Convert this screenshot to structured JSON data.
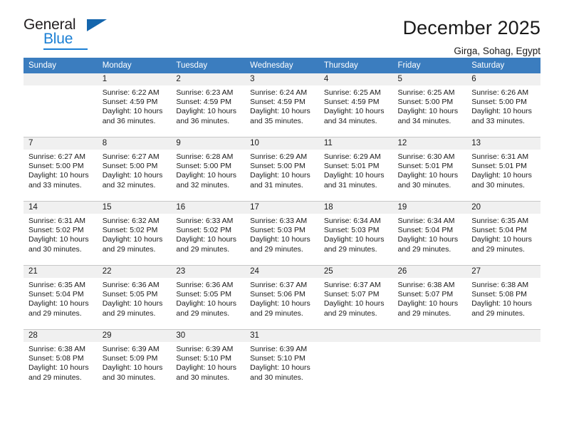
{
  "logo": {
    "word_top": "General",
    "word_bottom": "Blue",
    "accent_color": "#1b7fd4"
  },
  "header": {
    "title": "December 2025",
    "subtitle": "Girga, Sohag, Egypt",
    "header_bg": "#3b7dbf",
    "daynum_bg": "#f0f0f0"
  },
  "weekdays": [
    "Sunday",
    "Monday",
    "Tuesday",
    "Wednesday",
    "Thursday",
    "Friday",
    "Saturday"
  ],
  "labels": {
    "sunrise_prefix": "Sunrise:",
    "sunset_prefix": "Sunset:",
    "daylight_prefix": "Daylight:"
  },
  "weeks": [
    [
      {
        "day": "",
        "sunrise": "",
        "sunset": "",
        "daylight": ""
      },
      {
        "day": "1",
        "sunrise": "Sunrise: 6:22 AM",
        "sunset": "Sunset: 4:59 PM",
        "daylight": "Daylight: 10 hours and 36 minutes."
      },
      {
        "day": "2",
        "sunrise": "Sunrise: 6:23 AM",
        "sunset": "Sunset: 4:59 PM",
        "daylight": "Daylight: 10 hours and 36 minutes."
      },
      {
        "day": "3",
        "sunrise": "Sunrise: 6:24 AM",
        "sunset": "Sunset: 4:59 PM",
        "daylight": "Daylight: 10 hours and 35 minutes."
      },
      {
        "day": "4",
        "sunrise": "Sunrise: 6:25 AM",
        "sunset": "Sunset: 4:59 PM",
        "daylight": "Daylight: 10 hours and 34 minutes."
      },
      {
        "day": "5",
        "sunrise": "Sunrise: 6:25 AM",
        "sunset": "Sunset: 5:00 PM",
        "daylight": "Daylight: 10 hours and 34 minutes."
      },
      {
        "day": "6",
        "sunrise": "Sunrise: 6:26 AM",
        "sunset": "Sunset: 5:00 PM",
        "daylight": "Daylight: 10 hours and 33 minutes."
      }
    ],
    [
      {
        "day": "7",
        "sunrise": "Sunrise: 6:27 AM",
        "sunset": "Sunset: 5:00 PM",
        "daylight": "Daylight: 10 hours and 33 minutes."
      },
      {
        "day": "8",
        "sunrise": "Sunrise: 6:27 AM",
        "sunset": "Sunset: 5:00 PM",
        "daylight": "Daylight: 10 hours and 32 minutes."
      },
      {
        "day": "9",
        "sunrise": "Sunrise: 6:28 AM",
        "sunset": "Sunset: 5:00 PM",
        "daylight": "Daylight: 10 hours and 32 minutes."
      },
      {
        "day": "10",
        "sunrise": "Sunrise: 6:29 AM",
        "sunset": "Sunset: 5:00 PM",
        "daylight": "Daylight: 10 hours and 31 minutes."
      },
      {
        "day": "11",
        "sunrise": "Sunrise: 6:29 AM",
        "sunset": "Sunset: 5:01 PM",
        "daylight": "Daylight: 10 hours and 31 minutes."
      },
      {
        "day": "12",
        "sunrise": "Sunrise: 6:30 AM",
        "sunset": "Sunset: 5:01 PM",
        "daylight": "Daylight: 10 hours and 30 minutes."
      },
      {
        "day": "13",
        "sunrise": "Sunrise: 6:31 AM",
        "sunset": "Sunset: 5:01 PM",
        "daylight": "Daylight: 10 hours and 30 minutes."
      }
    ],
    [
      {
        "day": "14",
        "sunrise": "Sunrise: 6:31 AM",
        "sunset": "Sunset: 5:02 PM",
        "daylight": "Daylight: 10 hours and 30 minutes."
      },
      {
        "day": "15",
        "sunrise": "Sunrise: 6:32 AM",
        "sunset": "Sunset: 5:02 PM",
        "daylight": "Daylight: 10 hours and 29 minutes."
      },
      {
        "day": "16",
        "sunrise": "Sunrise: 6:33 AM",
        "sunset": "Sunset: 5:02 PM",
        "daylight": "Daylight: 10 hours and 29 minutes."
      },
      {
        "day": "17",
        "sunrise": "Sunrise: 6:33 AM",
        "sunset": "Sunset: 5:03 PM",
        "daylight": "Daylight: 10 hours and 29 minutes."
      },
      {
        "day": "18",
        "sunrise": "Sunrise: 6:34 AM",
        "sunset": "Sunset: 5:03 PM",
        "daylight": "Daylight: 10 hours and 29 minutes."
      },
      {
        "day": "19",
        "sunrise": "Sunrise: 6:34 AM",
        "sunset": "Sunset: 5:04 PM",
        "daylight": "Daylight: 10 hours and 29 minutes."
      },
      {
        "day": "20",
        "sunrise": "Sunrise: 6:35 AM",
        "sunset": "Sunset: 5:04 PM",
        "daylight": "Daylight: 10 hours and 29 minutes."
      }
    ],
    [
      {
        "day": "21",
        "sunrise": "Sunrise: 6:35 AM",
        "sunset": "Sunset: 5:04 PM",
        "daylight": "Daylight: 10 hours and 29 minutes."
      },
      {
        "day": "22",
        "sunrise": "Sunrise: 6:36 AM",
        "sunset": "Sunset: 5:05 PM",
        "daylight": "Daylight: 10 hours and 29 minutes."
      },
      {
        "day": "23",
        "sunrise": "Sunrise: 6:36 AM",
        "sunset": "Sunset: 5:05 PM",
        "daylight": "Daylight: 10 hours and 29 minutes."
      },
      {
        "day": "24",
        "sunrise": "Sunrise: 6:37 AM",
        "sunset": "Sunset: 5:06 PM",
        "daylight": "Daylight: 10 hours and 29 minutes."
      },
      {
        "day": "25",
        "sunrise": "Sunrise: 6:37 AM",
        "sunset": "Sunset: 5:07 PM",
        "daylight": "Daylight: 10 hours and 29 minutes."
      },
      {
        "day": "26",
        "sunrise": "Sunrise: 6:38 AM",
        "sunset": "Sunset: 5:07 PM",
        "daylight": "Daylight: 10 hours and 29 minutes."
      },
      {
        "day": "27",
        "sunrise": "Sunrise: 6:38 AM",
        "sunset": "Sunset: 5:08 PM",
        "daylight": "Daylight: 10 hours and 29 minutes."
      }
    ],
    [
      {
        "day": "28",
        "sunrise": "Sunrise: 6:38 AM",
        "sunset": "Sunset: 5:08 PM",
        "daylight": "Daylight: 10 hours and 29 minutes."
      },
      {
        "day": "29",
        "sunrise": "Sunrise: 6:39 AM",
        "sunset": "Sunset: 5:09 PM",
        "daylight": "Daylight: 10 hours and 30 minutes."
      },
      {
        "day": "30",
        "sunrise": "Sunrise: 6:39 AM",
        "sunset": "Sunset: 5:10 PM",
        "daylight": "Daylight: 10 hours and 30 minutes."
      },
      {
        "day": "31",
        "sunrise": "Sunrise: 6:39 AM",
        "sunset": "Sunset: 5:10 PM",
        "daylight": "Daylight: 10 hours and 30 minutes."
      },
      {
        "day": "",
        "sunrise": "",
        "sunset": "",
        "daylight": ""
      },
      {
        "day": "",
        "sunrise": "",
        "sunset": "",
        "daylight": ""
      },
      {
        "day": "",
        "sunrise": "",
        "sunset": "",
        "daylight": ""
      }
    ]
  ]
}
